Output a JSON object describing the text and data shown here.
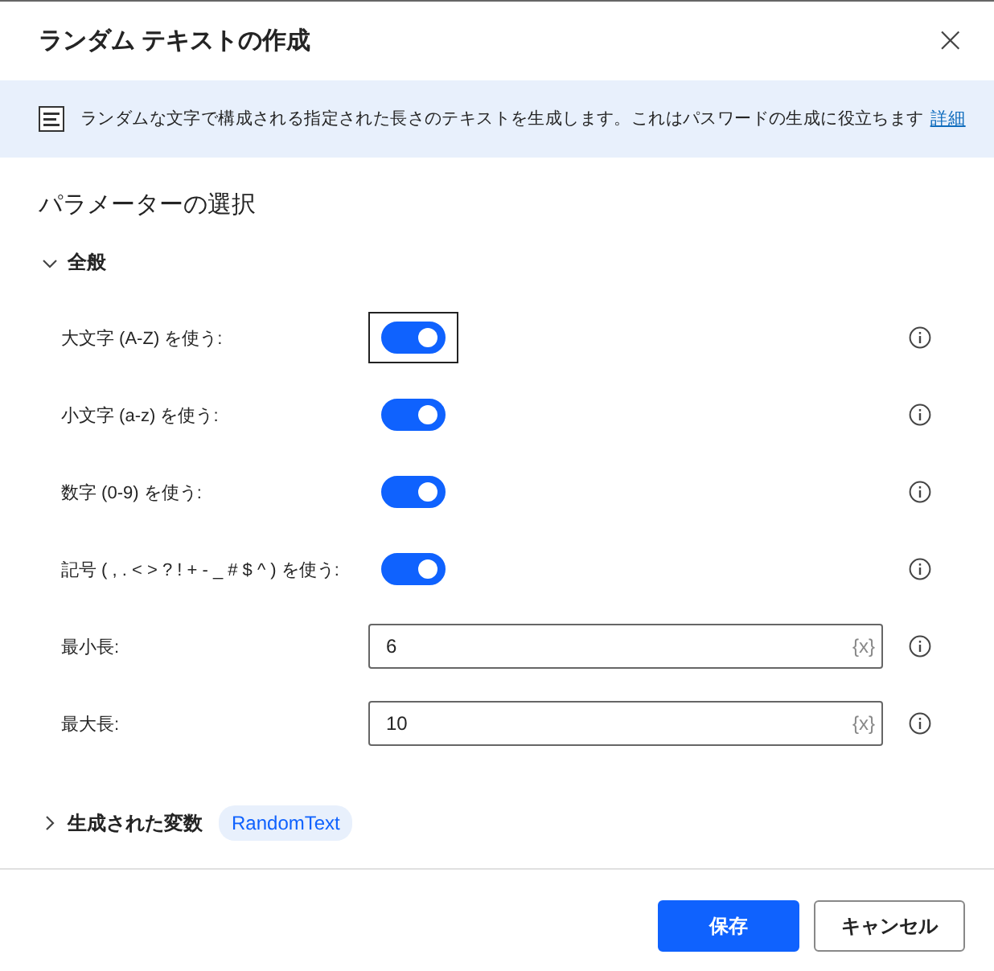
{
  "dialog": {
    "title": "ランダム テキストの作成",
    "close": "×"
  },
  "banner": {
    "text": "ランダムな文字で構成される指定された長さのテキストを生成します。これはパスワードの生成に役立ちます",
    "link": "詳細"
  },
  "heading": "パラメーターの選択",
  "section": {
    "label": "全般",
    "expanded": true
  },
  "parameters": [
    {
      "kind": "toggle",
      "label": "大文字 (A-Z) を使う:",
      "on": true,
      "focused": true
    },
    {
      "kind": "toggle",
      "label": "小文字 (a-z) を使う:",
      "on": true,
      "focused": false
    },
    {
      "kind": "toggle",
      "label": "数字 (0-9) を使う:",
      "on": true,
      "focused": false
    },
    {
      "kind": "toggle",
      "label": "記号 ( , . < > ? ! + - _ # $ ^ ) を使う:",
      "on": true,
      "focused": false
    },
    {
      "kind": "text",
      "label": "最小長:",
      "value": "6",
      "variable_hint": "{x}"
    },
    {
      "kind": "text",
      "label": "最大長:",
      "value": "10",
      "variable_hint": "{x}"
    }
  ],
  "variables": {
    "label": "生成された変数",
    "expanded": false,
    "chips": [
      "RandomText"
    ]
  },
  "buttons": [
    {
      "label": "保存",
      "primary": true
    },
    {
      "label": "キャンセル",
      "primary": false
    }
  ]
}
